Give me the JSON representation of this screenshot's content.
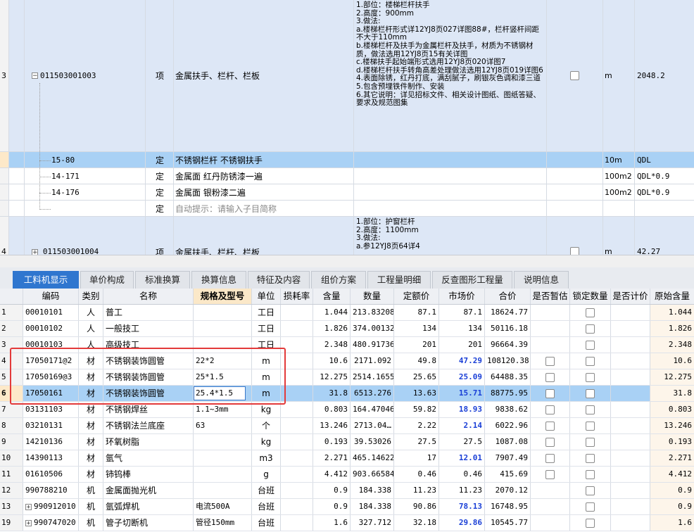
{
  "upper_rows": [
    {
      "num": "3",
      "code": "011503001003",
      "type": "项",
      "name": "金属扶手、栏杆、栏板",
      "features": "1.部位：楼梯栏杆扶手\n2.高度：900mm\n3.做法:\na.楼梯栏杆形式详12YJ8页027详图88#，栏杆竖杆间距不大于110mm\nb.楼梯栏杆及扶手为金属栏杆及扶手，材质为不锈钢材质，做法选用12YJ8页15有关详图\nc.楼梯扶手起始端形式选用12YJ8页020详图7\nd.楼梯栏杆扶手转角高差处理做法选用12YJ8页019详图6\n4.表面除锈，红丹打底，满刮腻子，刷银灰色调和漆三道\n5.包含预埋铁件制作、安装\n6.其它说明：详见招标文件、相关设计图纸、图纸答疑、要求及规范图集",
      "unit": "m",
      "qty": "2048.2"
    },
    {
      "code": "15-80",
      "type": "定",
      "name": "不锈钢栏杆 不锈钢扶手",
      "unit": "10m",
      "qty": "QDL"
    },
    {
      "code": "14-171",
      "type": "定",
      "name": "金属面 红丹防锈漆一遍",
      "unit": "100m2",
      "qty": "QDL*0.9"
    },
    {
      "code": "14-176",
      "type": "定",
      "name": "金属面 银粉漆二遍",
      "unit": "100m2",
      "qty": "QDL*0.9"
    },
    {
      "code": "",
      "type": "定",
      "name": "自动提示：请输入子目简称",
      "unit": "",
      "qty": ""
    },
    {
      "num": "4",
      "code": "011503001004",
      "type": "项",
      "name": "金属扶手、栏杆、栏板",
      "features": "1.部位：护窗栏杆\n2.高度：1100mm\n3.做法:\na.参12YJ8页64详4",
      "unit": "m",
      "qty": "42.27"
    }
  ],
  "tabs": [
    "工料机显示",
    "单价构成",
    "标准换算",
    "换算信息",
    "特征及内容",
    "组价方案",
    "工程量明细",
    "反查图形工程量",
    "说明信息"
  ],
  "columns": [
    "编码",
    "类别",
    "名称",
    "规格及型号",
    "单位",
    "损耗率",
    "含量",
    "数量",
    "定额价",
    "市场价",
    "合价",
    "是否暂估",
    "锁定数量",
    "是否计价",
    "原始含量"
  ],
  "rows": [
    {
      "no": "1",
      "code": "00010101",
      "cat": "人",
      "name": "普工",
      "spec": "",
      "unit": "工日",
      "qty": "1.044",
      "amt": "213.83208",
      "quota": "87.1",
      "mkt": "87.1",
      "mkt_bold": false,
      "total": "18624.77",
      "checks": false,
      "orig": "1.044"
    },
    {
      "no": "2",
      "code": "00010102",
      "cat": "人",
      "name": "一般技工",
      "spec": "",
      "unit": "工日",
      "qty": "1.826",
      "amt": "374.00132",
      "quota": "134",
      "mkt": "134",
      "mkt_bold": false,
      "total": "50116.18",
      "checks": false,
      "orig": "1.826"
    },
    {
      "no": "3",
      "code": "00010103",
      "cat": "人",
      "name": "高级技工",
      "spec": "",
      "unit": "工日",
      "qty": "2.348",
      "amt": "480.91736",
      "quota": "201",
      "mkt": "201",
      "mkt_bold": false,
      "total": "96664.39",
      "checks": false,
      "orig": "2.348"
    },
    {
      "no": "4",
      "code": "17050171@2",
      "cat": "材",
      "name": "不锈钢装饰圆管",
      "spec": "22*2",
      "unit": "m",
      "qty": "10.6",
      "amt": "2171.092",
      "quota": "49.8",
      "mkt": "47.29",
      "mkt_bold": true,
      "total": "108120.38",
      "checks": true,
      "orig": "10.6"
    },
    {
      "no": "5",
      "code": "17050169@3",
      "cat": "材",
      "name": "不锈钢装饰圆管",
      "spec": "25*1.5",
      "unit": "m",
      "qty": "12.275",
      "amt": "2514.1655",
      "quota": "25.65",
      "mkt": "25.09",
      "mkt_bold": true,
      "total": "64488.35",
      "checks": true,
      "orig": "12.275"
    },
    {
      "no": "6",
      "code": "17050161",
      "cat": "材",
      "name": "不锈钢装饰圆管",
      "spec": "25.4*1.5",
      "unit": "m",
      "qty": "31.8",
      "amt": "6513.276",
      "quota": "13.63",
      "mkt": "15.71",
      "mkt_bold": true,
      "total": "88775.95",
      "checks": true,
      "orig": "31.8",
      "selected": true
    },
    {
      "no": "7",
      "code": "03131103",
      "cat": "材",
      "name": "不锈钢焊丝",
      "spec": "1.1~3mm",
      "unit": "kg",
      "qty": "0.803",
      "amt": "164.47046",
      "quota": "59.82",
      "mkt": "18.93",
      "mkt_bold": true,
      "total": "9838.62",
      "checks": true,
      "orig": "0.803"
    },
    {
      "no": "8",
      "code": "03210131",
      "cat": "材",
      "name": "不锈钢法兰底座",
      "spec": "63",
      "unit": "个",
      "qty": "13.246",
      "amt": "2713.04…",
      "quota": "2.22",
      "mkt": "2.14",
      "mkt_bold": true,
      "total": "6022.96",
      "checks": true,
      "orig": "13.246"
    },
    {
      "no": "9",
      "code": "14210136",
      "cat": "材",
      "name": "环氧树脂",
      "spec": "",
      "unit": "kg",
      "qty": "0.193",
      "amt": "39.53026",
      "quota": "27.5",
      "mkt": "27.5",
      "mkt_bold": false,
      "total": "1087.08",
      "checks": true,
      "orig": "0.193"
    },
    {
      "no": "10",
      "code": "14390113",
      "cat": "材",
      "name": "氩气",
      "spec": "",
      "unit": "m3",
      "qty": "2.271",
      "amt": "465.14622",
      "quota": "17",
      "mkt": "12.01",
      "mkt_bold": true,
      "total": "7907.49",
      "checks": true,
      "orig": "2.271"
    },
    {
      "no": "11",
      "code": "01610506",
      "cat": "材",
      "name": "铈钨棒",
      "spec": "",
      "unit": "g",
      "qty": "4.412",
      "amt": "903.66584",
      "quota": "0.46",
      "mkt": "0.46",
      "mkt_bold": false,
      "total": "415.69",
      "checks": true,
      "orig": "4.412"
    },
    {
      "no": "12",
      "code": "990788210",
      "cat": "机",
      "name": "金属面抛光机",
      "spec": "",
      "unit": "台班",
      "qty": "0.9",
      "amt": "184.338",
      "quota": "11.23",
      "mkt": "11.23",
      "mkt_bold": false,
      "total": "2070.12",
      "checks": false,
      "orig": "0.9"
    },
    {
      "no": "13",
      "code": "990912010",
      "cat": "机",
      "name": "氩弧焊机",
      "spec": "电流500A",
      "unit": "台班",
      "qty": "0.9",
      "amt": "184.338",
      "quota": "90.86",
      "mkt": "78.13",
      "mkt_bold": true,
      "total": "16748.95",
      "checks": false,
      "orig": "0.9",
      "expander": true
    },
    {
      "no": "19",
      "code": "990747020",
      "cat": "机",
      "name": "管子切断机",
      "spec": "管径150mm",
      "unit": "台班",
      "qty": "1.6",
      "amt": "327.712",
      "quota": "32.18",
      "mkt": "29.86",
      "mkt_bold": true,
      "total": "10545.77",
      "checks": false,
      "orig": "1.6",
      "expander": true
    }
  ]
}
